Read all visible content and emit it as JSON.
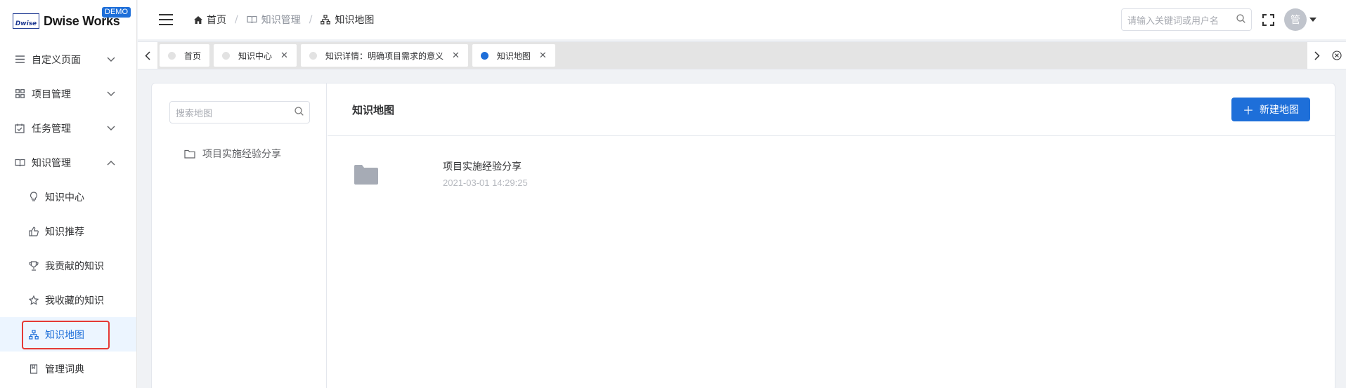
{
  "app": {
    "logo_mark": "Dwise",
    "logo_text": "Dwise Works",
    "badge": "DEMO"
  },
  "sidebar": {
    "items": [
      {
        "label": "自定义页面",
        "icon": "list-icon",
        "expanded": false
      },
      {
        "label": "项目管理",
        "icon": "grid-icon",
        "expanded": false
      },
      {
        "label": "任务管理",
        "icon": "calendar-check-icon",
        "expanded": false
      },
      {
        "label": "知识管理",
        "icon": "book-icon",
        "expanded": true
      }
    ],
    "sub_items": [
      {
        "label": "知识中心",
        "icon": "bulb-icon"
      },
      {
        "label": "知识推荐",
        "icon": "thumbs-up-icon"
      },
      {
        "label": "我贡献的知识",
        "icon": "trophy-icon"
      },
      {
        "label": "我收藏的知识",
        "icon": "star-icon"
      },
      {
        "label": "知识地图",
        "icon": "sitemap-icon",
        "active": true
      },
      {
        "label": "管理词典",
        "icon": "notebook-icon"
      }
    ]
  },
  "header": {
    "breadcrumb": [
      {
        "label": "首页",
        "icon": "home-icon"
      },
      {
        "label": "知识管理",
        "icon": "book-icon"
      },
      {
        "label": "知识地图",
        "icon": "sitemap-icon"
      }
    ],
    "search_placeholder": "请输入关键词或用户名",
    "avatar_text": "管"
  },
  "tabs": [
    {
      "label": "首页",
      "closable": false,
      "active": false
    },
    {
      "label": "知识中心",
      "closable": true,
      "active": false
    },
    {
      "label": "知识详情：明确项目需求的意义",
      "closable": true,
      "active": false
    },
    {
      "label": "知识地图",
      "closable": true,
      "active": true
    }
  ],
  "left_panel": {
    "search_placeholder": "搜索地图",
    "tree": [
      {
        "label": "项目实施经验分享"
      }
    ]
  },
  "main": {
    "title": "知识地图",
    "new_button": "新建地图",
    "maps": [
      {
        "name": "项目实施经验分享",
        "date": "2021-03-01 14:29:25"
      }
    ]
  },
  "colors": {
    "primary": "#1e6fd9",
    "highlight_outline": "#e53935"
  }
}
